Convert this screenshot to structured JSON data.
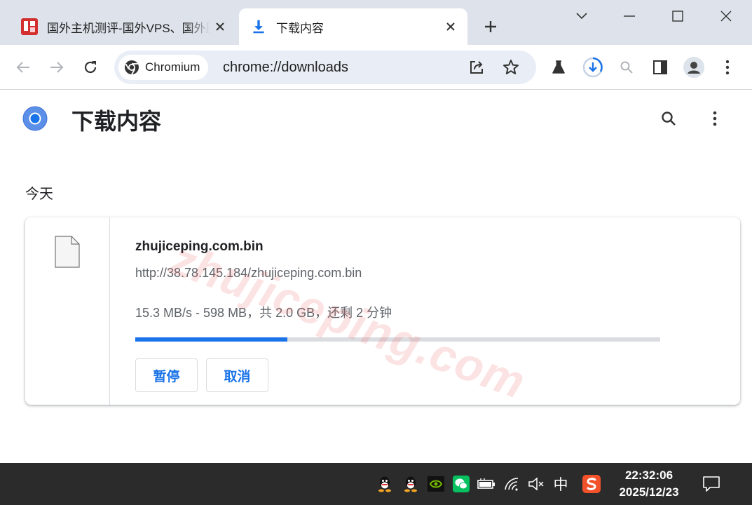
{
  "tabs": [
    {
      "title": "国外主机测评-国外VPS、国外服务器",
      "active": false
    },
    {
      "title": "下载内容",
      "active": true
    }
  ],
  "toolbar": {
    "chip_label": "Chromium",
    "url": "chrome://downloads"
  },
  "page": {
    "title": "下载内容",
    "section_date": "今天"
  },
  "download": {
    "file_name": "zhujiceping.com.bin",
    "url": "http://38.78.145.184/zhujiceping.com.bin",
    "status": "15.3 MB/s - 598 MB，共 2.0 GB，还剩 2 分钟",
    "progress_fraction": 0.29,
    "pause_label": "暂停",
    "cancel_label": "取消"
  },
  "watermark": "zhujiceping.com",
  "taskbar": {
    "ime_label": "中",
    "time": "22:32:06",
    "date": "2025/12/23"
  },
  "colors": {
    "accent": "#1a73e8",
    "tabstrip": "#dee3eb",
    "omnibox": "#e9eef6"
  }
}
